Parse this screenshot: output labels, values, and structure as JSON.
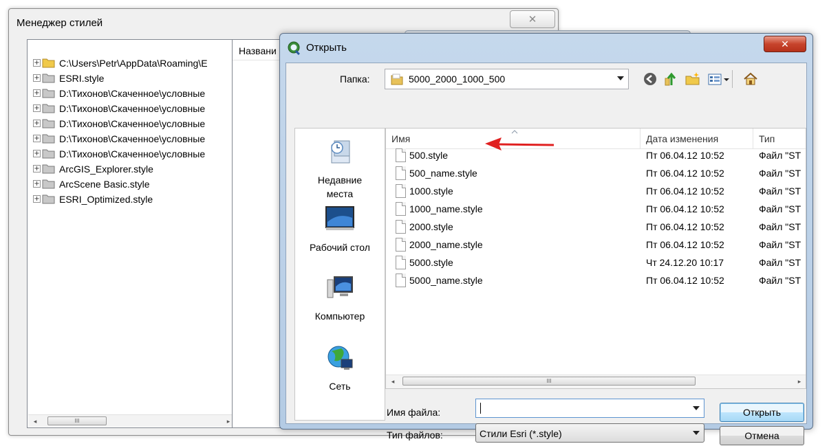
{
  "style_manager": {
    "title": "Менеджер стилей",
    "close_glyph": "✕",
    "tree": [
      {
        "label": "C:\\Users\\Petr\\AppData\\Roaming\\E",
        "open_folder": true
      },
      {
        "label": "ESRI.style",
        "open_folder": false
      },
      {
        "label": "D:\\Тихонов\\Скаченное\\условные",
        "open_folder": false
      },
      {
        "label": "D:\\Тихонов\\Скаченное\\условные",
        "open_folder": false
      },
      {
        "label": "D:\\Тихонов\\Скаченное\\условные",
        "open_folder": false
      },
      {
        "label": "D:\\Тихонов\\Скаченное\\условные",
        "open_folder": false
      },
      {
        "label": "D:\\Тихонов\\Скаченное\\условные",
        "open_folder": false
      },
      {
        "label": "ArcGIS_Explorer.style",
        "open_folder": false
      },
      {
        "label": "ArcScene Basic.style",
        "open_folder": false
      },
      {
        "label": "ESRI_Optimized.style",
        "open_folder": false
      }
    ],
    "list_header": "Названи"
  },
  "open_dialog": {
    "title": "Открыть",
    "close_glyph": "✕",
    "folder_label": "Папка:",
    "folder_value": "5000_2000_1000_500",
    "places": [
      {
        "label": "Недавние\nместа",
        "icon": "recent-places-icon"
      },
      {
        "label": "Рабочий стол",
        "icon": "desktop-icon"
      },
      {
        "label": "Компьютер",
        "icon": "computer-icon"
      },
      {
        "label": "Сеть",
        "icon": "network-icon"
      }
    ],
    "columns": {
      "name": "Имя",
      "date": "Дата изменения",
      "type": "Тип"
    },
    "files": [
      {
        "name": "500.style",
        "date": "Пт 06.04.12 10:52",
        "type": "Файл \"ST"
      },
      {
        "name": "500_name.style",
        "date": "Пт 06.04.12 10:52",
        "type": "Файл \"ST"
      },
      {
        "name": "1000.style",
        "date": "Пт 06.04.12 10:52",
        "type": "Файл \"ST"
      },
      {
        "name": "1000_name.style",
        "date": "Пт 06.04.12 10:52",
        "type": "Файл \"ST"
      },
      {
        "name": "2000.style",
        "date": "Пт 06.04.12 10:52",
        "type": "Файл \"ST"
      },
      {
        "name": "2000_name.style",
        "date": "Пт 06.04.12 10:52",
        "type": "Файл \"ST"
      },
      {
        "name": "5000.style",
        "date": "Чт 24.12.20 10:17",
        "type": "Файл \"ST"
      },
      {
        "name": "5000_name.style",
        "date": "Пт 06.04.12 10:52",
        "type": "Файл \"ST"
      }
    ],
    "filename_label": "Имя файла:",
    "filename_value": "",
    "filetype_label": "Тип файлов:",
    "filetype_value": "Стили Esri (*.style)",
    "open_button": "Открыть",
    "cancel_button": "Отмена",
    "scroll_grip": "III",
    "scroll_left": "◂",
    "scroll_right": "▸"
  },
  "annotation": {
    "arrow_color": "#e02020",
    "points_to": "500_name.style"
  }
}
